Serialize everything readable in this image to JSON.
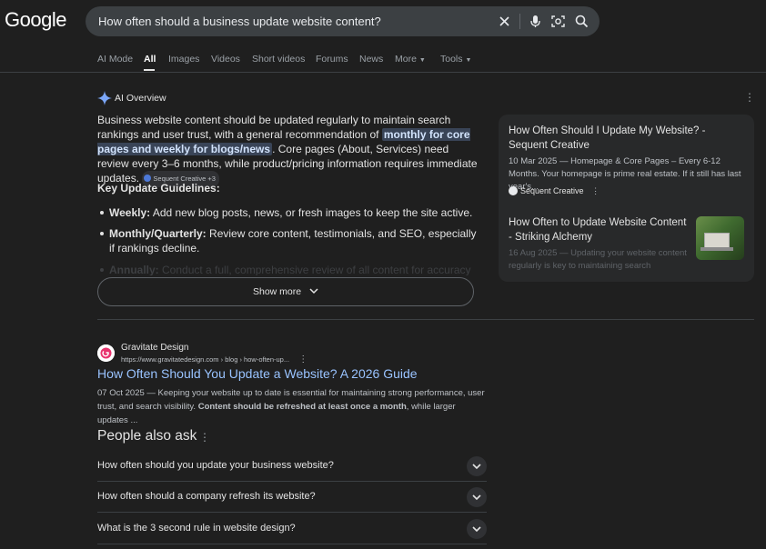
{
  "logo": "Google",
  "search": {
    "query": "How often should a business update website content?"
  },
  "tabs": [
    {
      "label": "AI Mode"
    },
    {
      "label": "All"
    },
    {
      "label": "Images"
    },
    {
      "label": "Videos"
    },
    {
      "label": "Short videos"
    },
    {
      "label": "Forums"
    },
    {
      "label": "News"
    },
    {
      "label": "More"
    },
    {
      "label": "Tools"
    }
  ],
  "ai_overview": {
    "title": "AI Overview",
    "p1_a": "Business website content should be updated regularly to maintain search rankings and user trust, with a general recommendation of ",
    "p1_hl": "monthly for core pages and weekly for blogs/news",
    "p1_b": ". Core pages (About, Services) need review every 3–6 months, while product/pricing information requires immediate updates.",
    "chip": "Sequent Creative +3",
    "key_heading": "Key Update Guidelines:",
    "bullets": [
      {
        "label": "Weekly:",
        "text": " Add new blog posts, news, or fresh images to keep the site active."
      },
      {
        "label": "Monthly/Quarterly:",
        "text": " Review core content, testimonials, and SEO, especially if rankings decline."
      },
      {
        "label": "Annually:",
        "text": " Conduct a full, comprehensive review of all content for accuracy and"
      }
    ],
    "show_more": "Show more"
  },
  "side_cards": [
    {
      "title": "How Often Should I Update My Website? - Sequent Creative",
      "snippet": "10 Mar 2025 — Homepage & Core Pages – Every 6-12 Months. Your homepage is prime real estate. If it still has last year's...",
      "source": "Sequent Creative"
    },
    {
      "title": "How Often to Update Website Content - Striking Alchemy",
      "snippet": "16 Aug 2025 — Updating your website content regularly is key to maintaining search rankings..."
    }
  ],
  "result": {
    "site": "Gravitate Design",
    "url": "https://www.gravitatedesign.com › blog › how-often-up...",
    "title": "How Often Should You Update a Website? A 2026 Guide",
    "snippet_a": "07 Oct 2025 — Keeping your website up to date is essential for maintaining strong performance, user trust, and search visibility. ",
    "snippet_b": "Content should be refreshed at least once a month",
    "snippet_c": ", while larger updates ..."
  },
  "paa": {
    "title": "People also ask",
    "questions": [
      "How often should you update your business website?",
      "How often should a company refresh its website?",
      "What is the 3 second rule in website design?"
    ]
  },
  "colors": {
    "link": "#99c3ff",
    "highlight_bg": "#394457",
    "bg": "#1f1f1f"
  }
}
